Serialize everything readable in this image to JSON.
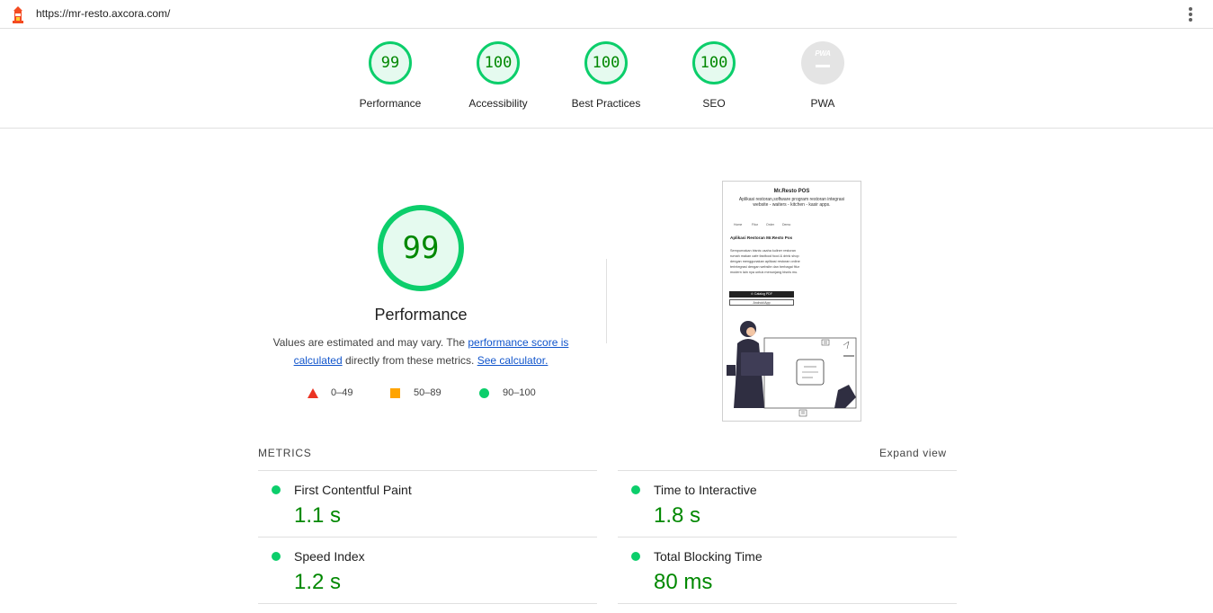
{
  "address_bar": {
    "url": "https://mr-resto.axcora.com/",
    "logo_icon": "lighthouse-icon",
    "menu_icon": "more-vert-icon"
  },
  "gauges": [
    {
      "label": "Performance",
      "score": "99",
      "value": 99
    },
    {
      "label": "Accessibility",
      "score": "100",
      "value": 100
    },
    {
      "label": "Best Practices",
      "score": "100",
      "value": 100
    },
    {
      "label": "SEO",
      "score": "100",
      "value": 100
    },
    {
      "label": "PWA",
      "score": "",
      "badge_text": "PWA"
    }
  ],
  "performance": {
    "score": "99",
    "value": 99,
    "title": "Performance",
    "desc_before": "Values are estimated and may vary. The ",
    "score_link": "performance score is calculated",
    "desc_middle": " directly from these metrics. ",
    "calc_link": "See calculator."
  },
  "legend": [
    {
      "shape": "triangle",
      "range": "0–49",
      "color": "#eb3323"
    },
    {
      "shape": "square",
      "range": "50–89",
      "color": "#ffa400"
    },
    {
      "shape": "circle",
      "range": "90–100",
      "color": "#0cce6b"
    }
  ],
  "screenshot": {
    "title": "Mr.Resto POS",
    "subtitle": "Aplikasi restoran,software program restoran integrasi website - waiters - kitchen - kasir apps.",
    "nav": [
      "Home",
      "Fitur",
      "Order",
      "Demo"
    ],
    "heading": "Aplikasi Restoran Mr.Resto Pos",
    "body": "Sempurnakan bisnis usaha kuliner restoran rumah makan cafe fastfood food & drink shop dengan menggunakan aplikasi restoran online terintegrasi dengan website dan berbagai fitur modern lain nya untuk menunjang bisnis mu.",
    "btn_primary": "⊙ Catalog PDF",
    "btn_secondary": "Android App"
  },
  "metrics": {
    "title": "METRICS",
    "expand": "Expand view",
    "items": [
      {
        "name": "First Contentful Paint",
        "value": "1.1 s"
      },
      {
        "name": "Time to Interactive",
        "value": "1.8 s"
      },
      {
        "name": "Speed Index",
        "value": "1.2 s"
      },
      {
        "name": "Total Blocking Time",
        "value": "80 ms"
      }
    ]
  },
  "colors": {
    "pass": "#0cce6b",
    "pass_text": "#008800",
    "pass_fill": "#e5faef",
    "link": "#1155cc"
  }
}
